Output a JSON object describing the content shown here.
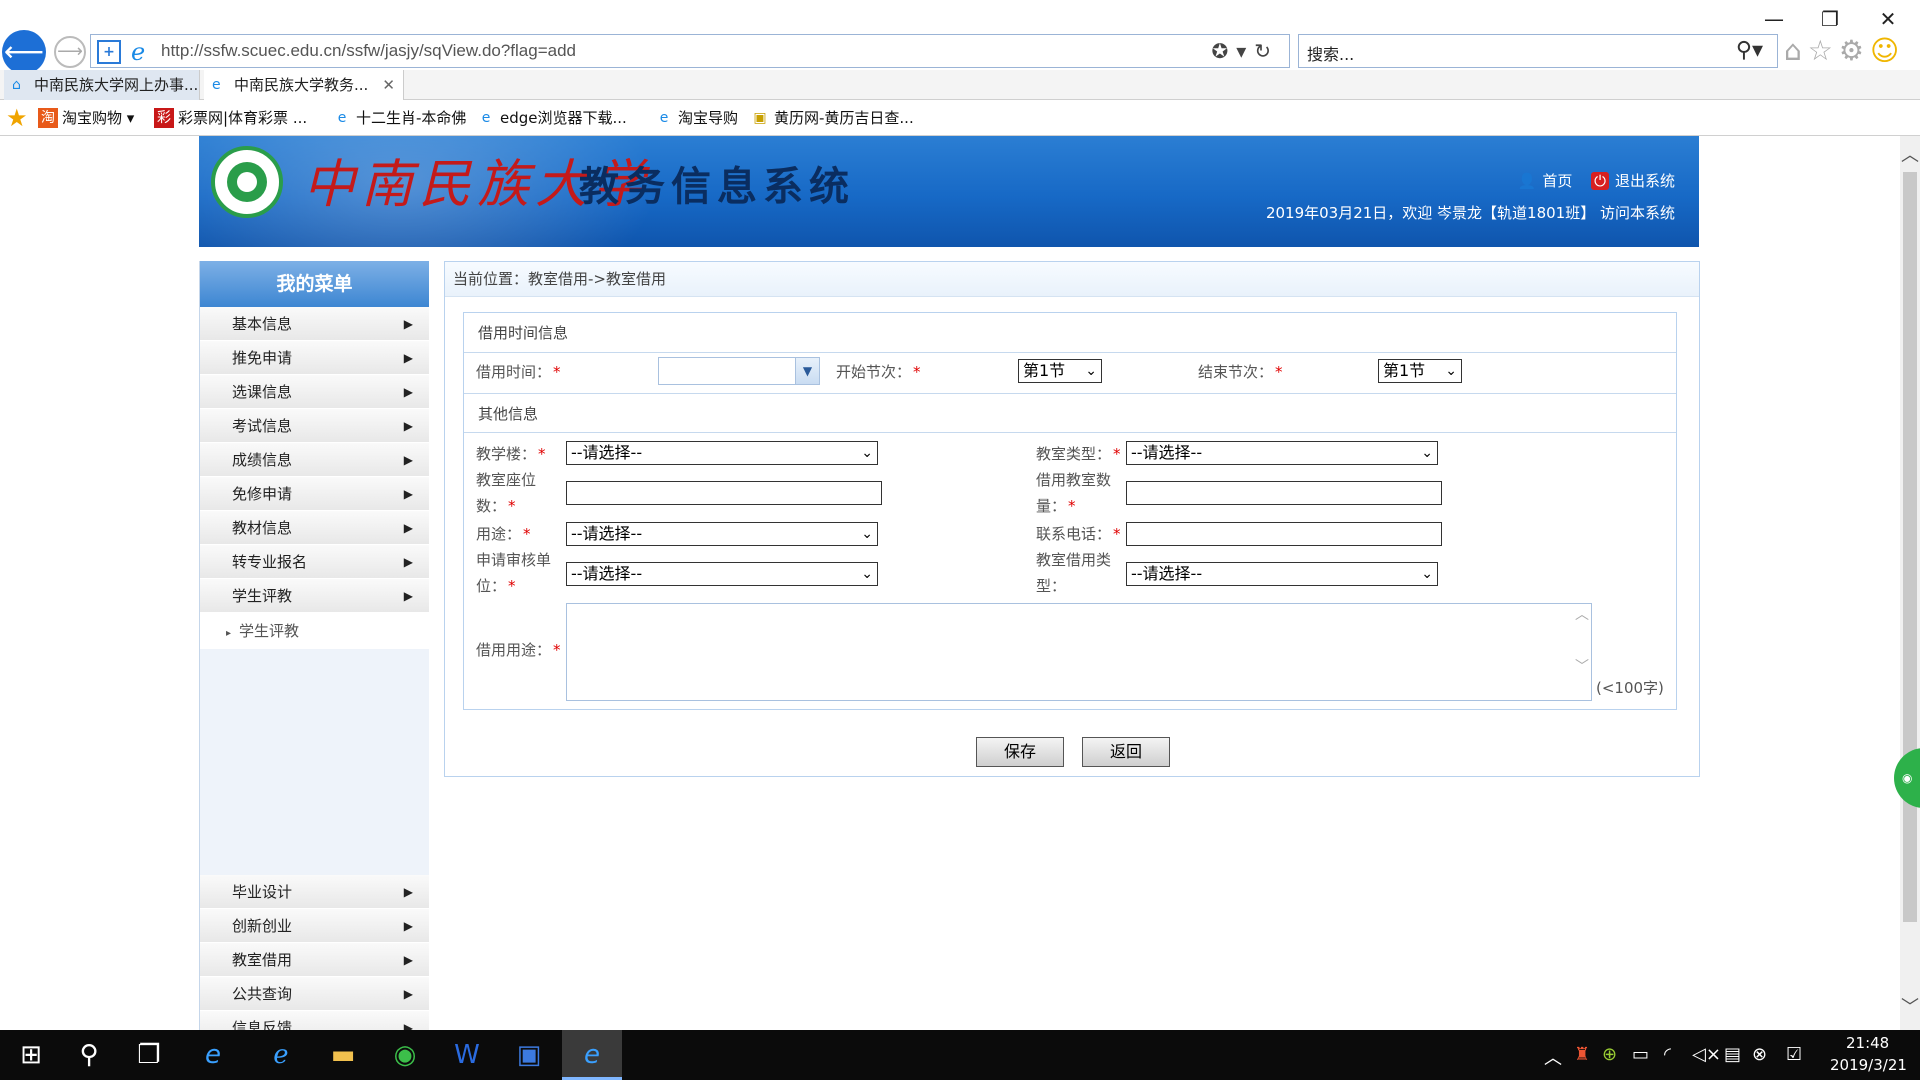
{
  "browser": {
    "address": "http://ssfw.scuec.edu.cn/ssfw/jasjy/sqView.do?flag=add",
    "search_placeholder": "搜索...",
    "tabs": [
      {
        "label": "中南民族大学网上办事..."
      },
      {
        "label": "中南民族大学教务..."
      }
    ],
    "favorites": [
      {
        "label": "淘宝购物"
      },
      {
        "label": "彩票网|体育彩票 ..."
      },
      {
        "label": "十二生肖-本命佛"
      },
      {
        "label": "edge浏览器下载..."
      },
      {
        "label": "淘宝导购"
      },
      {
        "label": "黄历网-黄历吉日查..."
      }
    ]
  },
  "header": {
    "school_name": "中南民族大学",
    "system_title": "教务信息系统",
    "home_link": "首页",
    "logout_link": "退出系统",
    "welcome": "2019年03月21日，欢迎 岑景龙【轨道1801班】 访问本系统"
  },
  "menu": {
    "title": "我的菜单",
    "items_top": [
      {
        "label": "基本信息"
      },
      {
        "label": "推免申请"
      },
      {
        "label": "选课信息"
      },
      {
        "label": "考试信息"
      },
      {
        "label": "成绩信息"
      },
      {
        "label": "免修申请"
      },
      {
        "label": "教材信息"
      },
      {
        "label": "转专业报名"
      },
      {
        "label": "学生评教"
      }
    ],
    "sub_item": "学生评教",
    "items_bottom": [
      {
        "label": "毕业设计"
      },
      {
        "label": "创新创业"
      },
      {
        "label": "教室借用"
      },
      {
        "label": "公共查询"
      },
      {
        "label": "信息反馈"
      }
    ]
  },
  "main": {
    "breadcrumb": "当前位置：教室借用->教室借用",
    "section_time": "借用时间信息",
    "section_other": "其他信息",
    "time_label": "借用时间：",
    "start_label": "开始节次：",
    "end_label": "结束节次：",
    "start_value": "第1节",
    "end_value": "第1节",
    "building_label": "教学楼：",
    "room_type_label": "教室类型：",
    "seats_label_1": "教室座位",
    "seats_label_2": "数：",
    "count_label_1": "借用教室数",
    "count_label_2": "量：",
    "usage_label": "用途：",
    "phone_label": "联系电话：",
    "audit_label_1": "申请审核单",
    "audit_label_2": "位：",
    "borrow_type_label_1": "教室借用类",
    "borrow_type_label_2": "型：",
    "purpose_label": "借用用途：",
    "select_placeholder": "--请选择--",
    "char_limit": "(<100字)",
    "save": "保存",
    "back": "返回"
  },
  "taskbar": {
    "time": "21:48",
    "date": "2019/3/21"
  }
}
